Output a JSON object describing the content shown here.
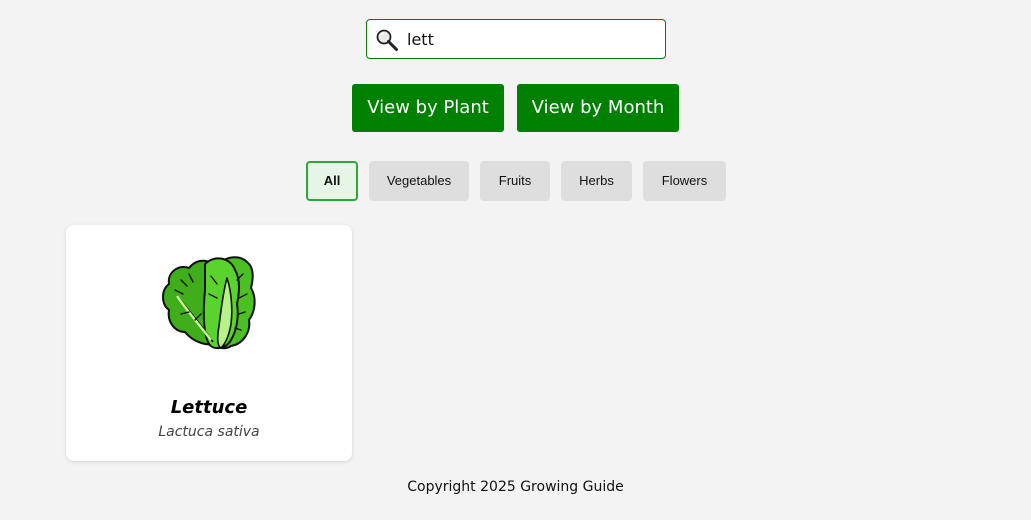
{
  "search": {
    "value": "lett",
    "icon": "magnifying-glass-icon"
  },
  "view_buttons": {
    "by_plant": "View by Plant",
    "by_month": "View by Month",
    "color": "#008000"
  },
  "filters": {
    "active": "All",
    "items": [
      "All",
      "Vegetables",
      "Fruits",
      "Herbs",
      "Flowers"
    ]
  },
  "results": [
    {
      "name": "Lettuce",
      "scientific_name": "Lactuca sativa",
      "icon": "lettuce-icon"
    }
  ],
  "footer": {
    "text": "Copyright 2025 Growing Guide"
  },
  "colors": {
    "accent": "#008000",
    "active_filter_border": "#2fa63a",
    "background": "#f3f3f3"
  }
}
